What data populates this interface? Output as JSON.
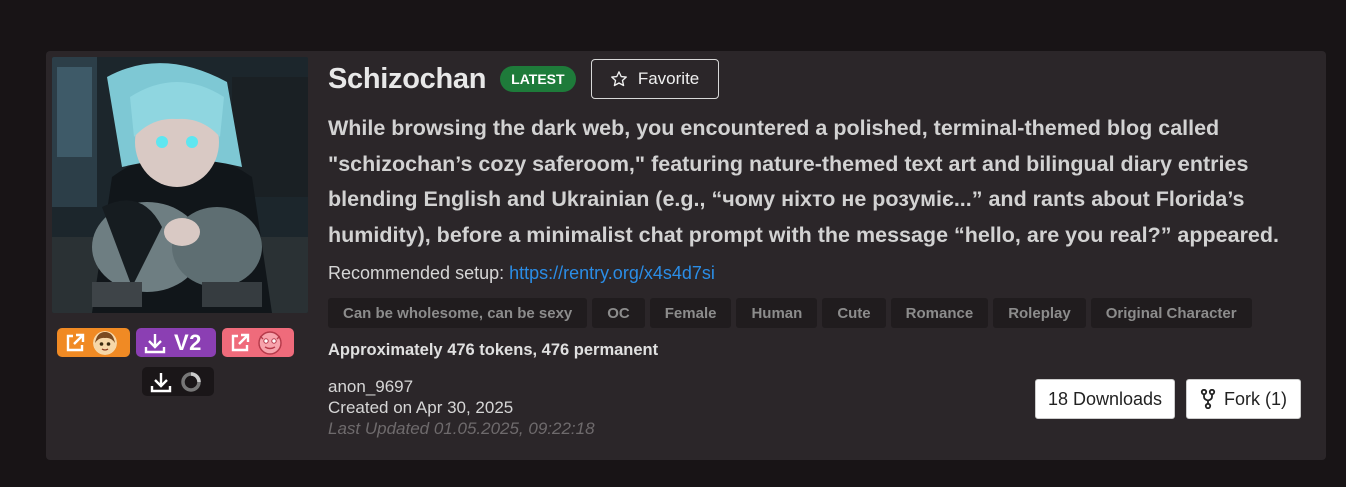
{
  "character": {
    "name": "Schizochan",
    "badge": "LATEST",
    "favorite_label": "Favorite",
    "description": "While browsing the dark web, you encountered a polished, terminal-themed blog called \"schizochan’s cozy saferoom,\" featuring nature-themed text art and bilingual diary entries blending English and Ukrainian (e.g., “чому ніхто не розуміє...” and rants about Florida’s humidity), before a minimalist chat prompt with the message “hello, are you real?” appeared.",
    "setup_prefix": "Recommended setup: ",
    "setup_link": "https://rentry.org/x4s4d7si",
    "tags": [
      "Can be wholesome, can be sexy",
      "OC",
      "Female",
      "Human",
      "Cute",
      "Romance",
      "Roleplay",
      "Original Character"
    ],
    "tokens": "Approximately 476 tokens, 476 permanent",
    "author": "anon_9697",
    "created": "Created on Apr 30, 2025",
    "updated": "Last Updated 01.05.2025, 09:22:18"
  },
  "actions": {
    "v2_label": "V2",
    "downloads_label": "18 Downloads",
    "fork_label": "Fork (1)"
  },
  "colors": {
    "background": "#181416",
    "card": "#2b2629",
    "latest_badge": "#1e7b3a",
    "link": "#2b8de6",
    "orange_button": "#f08a24",
    "purple_button": "#8b3fb3",
    "pink_button": "#ef6b7b"
  },
  "icons": [
    "external-link-icon",
    "download-icon",
    "star-icon",
    "fork-icon",
    "avatar-face-icon",
    "chub-face-icon",
    "loading-ring-icon"
  ]
}
